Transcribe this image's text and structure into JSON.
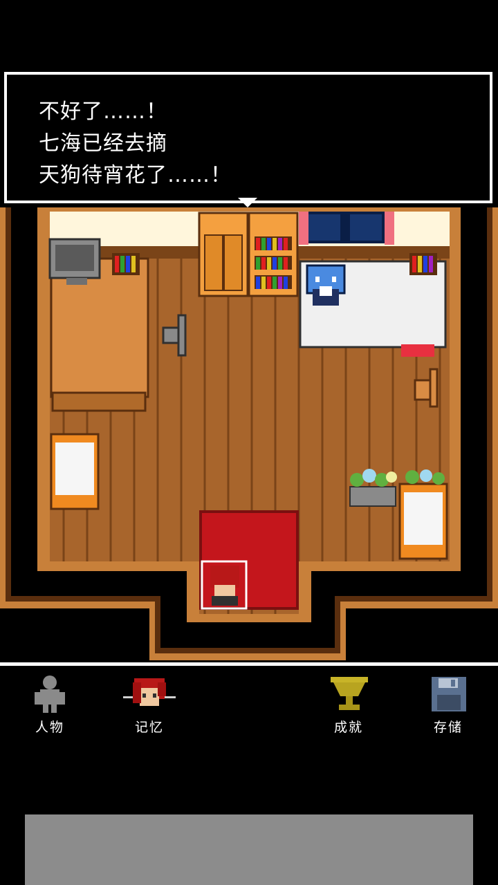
{
  "dialog": {
    "lines": [
      "不好了……！",
      "七海已经去摘",
      "天狗待宵花了……！"
    ]
  },
  "menu": {
    "characters_label": "人物",
    "memories_label": "记忆",
    "achievements_label": "成就",
    "save_label": "存储"
  },
  "icons": {
    "characters": "person-silhouette-icon",
    "memories": "red-haired-portrait-icon",
    "achievements": "trophy-icon",
    "save": "floppy-disk-icon"
  },
  "colors": {
    "floor": "#a8652c",
    "wall_trim": "#c8803a",
    "rug": "#c4161c",
    "dialog_border": "#ffffff"
  }
}
